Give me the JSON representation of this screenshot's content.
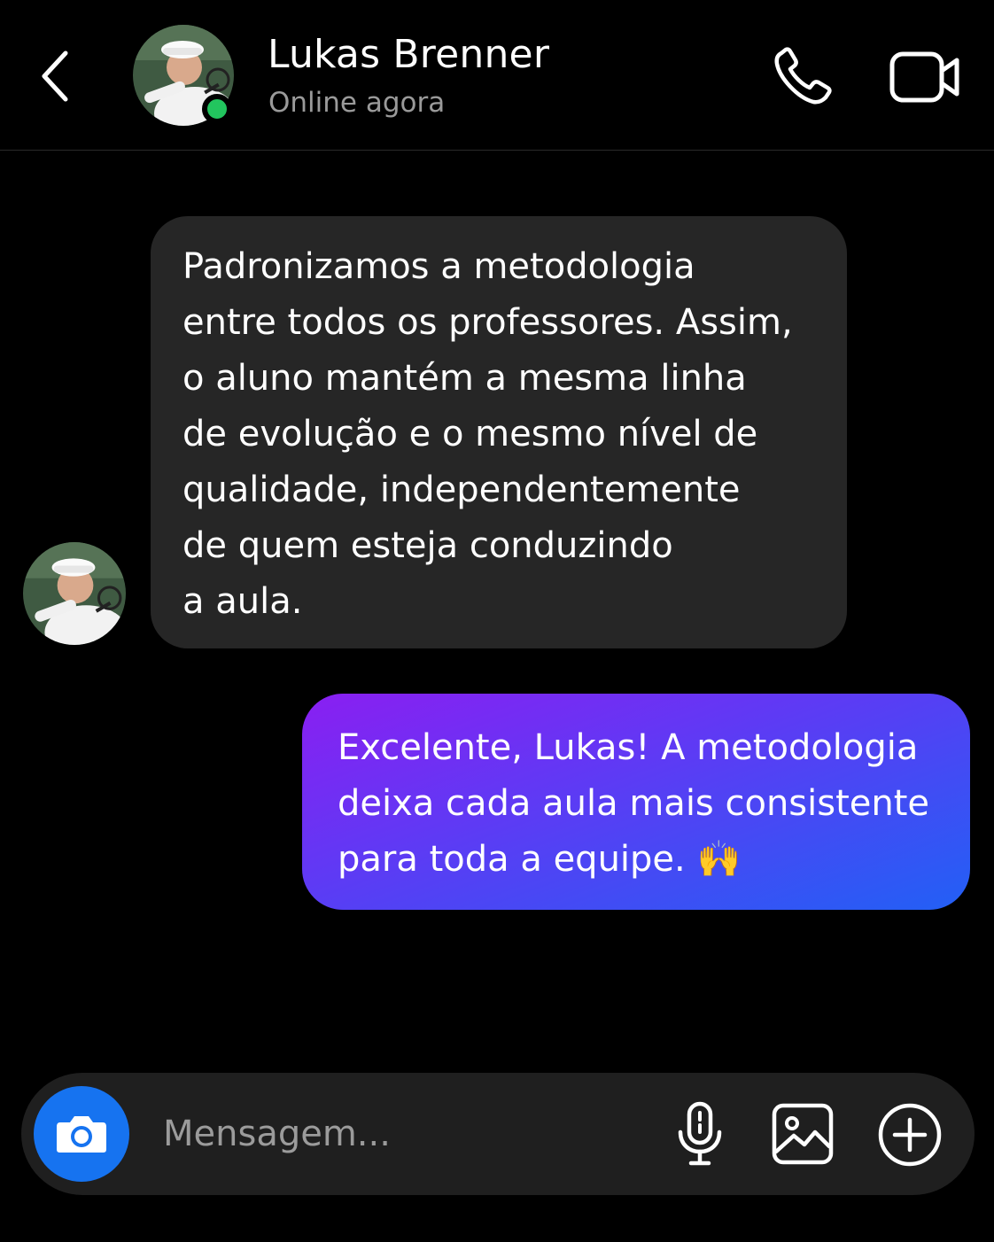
{
  "header": {
    "contact_name": "Lukas Brenner",
    "status": "Online agora",
    "icons": {
      "back": "chevron-left-icon",
      "call": "phone-icon",
      "video": "video-camera-icon"
    }
  },
  "messages": [
    {
      "direction": "incoming",
      "text": "Padronizamos a metodologia\nentre todos os professores. Assim,\no aluno mantém a mesma linha\nde evolução e o mesmo nível de\nqualidade, independentemente\nde quem esteja conduzindo\na aula."
    },
    {
      "direction": "outgoing",
      "text": "Excelente, Lukas! A metodologia\ndeixa cada aula mais consistente\npara toda a equipe. 🙌"
    }
  ],
  "composer": {
    "placeholder": "Mensagem...",
    "icons": {
      "camera": "camera-icon",
      "mic": "microphone-icon",
      "gallery": "image-icon",
      "add": "plus-circle-icon"
    }
  },
  "colors": {
    "background": "#000000",
    "incoming_bubble": "#262626",
    "outgoing_gradient_start": "#8a1ff2",
    "outgoing_gradient_end": "#2260f5",
    "online_indicator": "#22c55e",
    "camera_button": "#1673f0"
  }
}
